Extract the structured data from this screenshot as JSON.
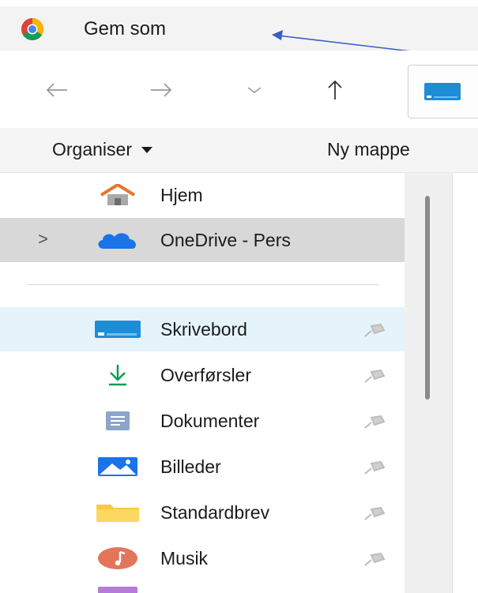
{
  "window": {
    "title": "Gem som",
    "app_icon": "chrome-icon"
  },
  "nav": {
    "back_icon": "back-arrow-icon",
    "forward_icon": "forward-arrow-icon",
    "recent_icon": "chevron-down-icon",
    "up_icon": "up-arrow-icon",
    "location_icon": "desktop-folder-icon"
  },
  "commands": {
    "organise_label": "Organiser",
    "new_folder_label": "Ny mappe"
  },
  "sidebar": {
    "items": [
      {
        "label": "Hjem",
        "icon": "home-icon",
        "pinned": false
      },
      {
        "label": "OneDrive - Pers",
        "icon": "onedrive-cloud-icon",
        "pinned": false,
        "expander": ">"
      },
      {
        "label": "Skrivebord",
        "icon": "desktop-folder-icon",
        "pinned": true
      },
      {
        "label": "Overførsler",
        "icon": "download-icon",
        "pinned": true
      },
      {
        "label": "Dokumenter",
        "icon": "documents-icon",
        "pinned": true
      },
      {
        "label": "Billeder",
        "icon": "pictures-icon",
        "pinned": true
      },
      {
        "label": "Standardbrev",
        "icon": "folder-icon",
        "pinned": true
      },
      {
        "label": "Musik",
        "icon": "music-icon",
        "pinned": true
      }
    ]
  },
  "colors": {
    "selected_bg": "#e5f3fb",
    "hover_bg": "#d8d8d8",
    "accent_blue": "#1e6fd9",
    "annotation_arrow": "#3a5ec8"
  }
}
